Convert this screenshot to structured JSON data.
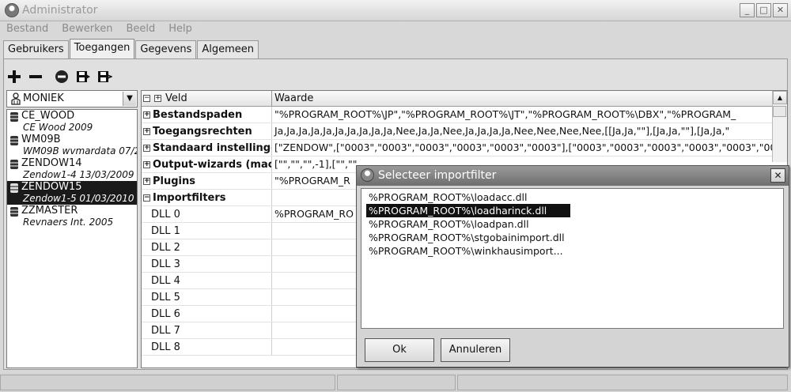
{
  "window": {
    "title": "Administrator",
    "buttons": [
      "_",
      "□",
      "✕"
    ]
  },
  "menu": [
    "Bestand",
    "Bewerken",
    "Beeld",
    "Help"
  ],
  "tabs": [
    {
      "label": "Gebruikers",
      "active": false
    },
    {
      "label": "Toegangen",
      "active": true
    },
    {
      "label": "Gegevens",
      "active": false
    },
    {
      "label": "Algemeen",
      "active": false
    }
  ],
  "toolbar": {
    "icons": [
      "plus-icon",
      "minus-icon",
      "remove-circle-icon",
      "save-icon",
      "save-as-icon"
    ]
  },
  "user_combo": {
    "value": "MONIEK"
  },
  "users": [
    {
      "name": "CE_WOOD",
      "desc": "CE Wood 2009",
      "selected": false
    },
    {
      "name": "WM09B",
      "desc": "WM09B wvmardata 07/2",
      "selected": false
    },
    {
      "name": "ZENDOW14",
      "desc": "Zendow1-4 13/03/2009",
      "selected": false
    },
    {
      "name": "ZENDOW15",
      "desc": "Zendow1-5 01/03/2010",
      "selected": true
    },
    {
      "name": "ZZMASTER",
      "desc": "Revnaers Int. 2005",
      "selected": false
    }
  ],
  "grid": {
    "header": {
      "col1": "Veld",
      "col2": "Waarde"
    },
    "rows": [
      {
        "field": "Bestandspaden",
        "value": "\"%PROGRAM_ROOT%\\JP\",\"%PROGRAM_ROOT%\\JT\",\"%PROGRAM_ROOT%\\DBX\",\"%PROGRAM_",
        "bold": true,
        "toggle": "+"
      },
      {
        "field": "Toegangsrechten",
        "value": "Ja,Ja,Ja,Ja,Ja,Ja,Ja,Ja,Ja,Ja,Nee,Ja,Ja,Nee,Ja,Ja,Ja,Ja,Nee,Nee,Nee,Nee,[[Ja,Ja,\"\"],[Ja,Ja,\"\"],[Ja,Ja,\"",
        "bold": true,
        "toggle": "+"
      },
      {
        "field": "Standaard instellingen",
        "value": "[\"ZENDOW\",[\"0003\",\"0003\",\"0003\",\"0003\",\"0003\",\"0003\"],[\"0003\",\"0003\",\"0003\",\"0003\",\"0003\",\"0003\"],[\"00",
        "bold": true,
        "toggle": "+"
      },
      {
        "field": "Output-wizards (machi",
        "value": "[\"\",\"\",\"\",-1],[\"\",\"\",",
        "bold": true,
        "toggle": "+"
      },
      {
        "field": "Plugins",
        "value": "\"%PROGRAM_R",
        "bold": true,
        "toggle": "+"
      },
      {
        "field": "Importfilters",
        "value": "",
        "bold": true,
        "toggle": "−"
      },
      {
        "field": "DLL 0",
        "value": "%PROGRAM_RO",
        "bold": false,
        "toggle": ""
      },
      {
        "field": "DLL 1",
        "value": "",
        "bold": false,
        "toggle": ""
      },
      {
        "field": "DLL 2",
        "value": "",
        "bold": false,
        "toggle": ""
      },
      {
        "field": "DLL 3",
        "value": "",
        "bold": false,
        "toggle": ""
      },
      {
        "field": "DLL 4",
        "value": "",
        "bold": false,
        "toggle": ""
      },
      {
        "field": "DLL 5",
        "value": "",
        "bold": false,
        "toggle": ""
      },
      {
        "field": "DLL 6",
        "value": "",
        "bold": false,
        "toggle": ""
      },
      {
        "field": "DLL 7",
        "value": "",
        "bold": false,
        "toggle": ""
      },
      {
        "field": "DLL 8",
        "value": "",
        "bold": false,
        "toggle": ""
      }
    ]
  },
  "dialog": {
    "title": "Selecteer importfilter",
    "items": [
      {
        "label": "%PROGRAM_ROOT%\\loadacc.dll",
        "selected": false
      },
      {
        "label": "%PROGRAM_ROOT%\\loadharinck.dll",
        "selected": true
      },
      {
        "label": "%PROGRAM_ROOT%\\loadpan.dll",
        "selected": false
      },
      {
        "label": "%PROGRAM_ROOT%\\stgobainimport.dll",
        "selected": false
      },
      {
        "label": "%PROGRAM_ROOT%\\winkhausimport...",
        "selected": false
      }
    ],
    "ok_label": "Ok",
    "cancel_label": "Annuleren"
  }
}
